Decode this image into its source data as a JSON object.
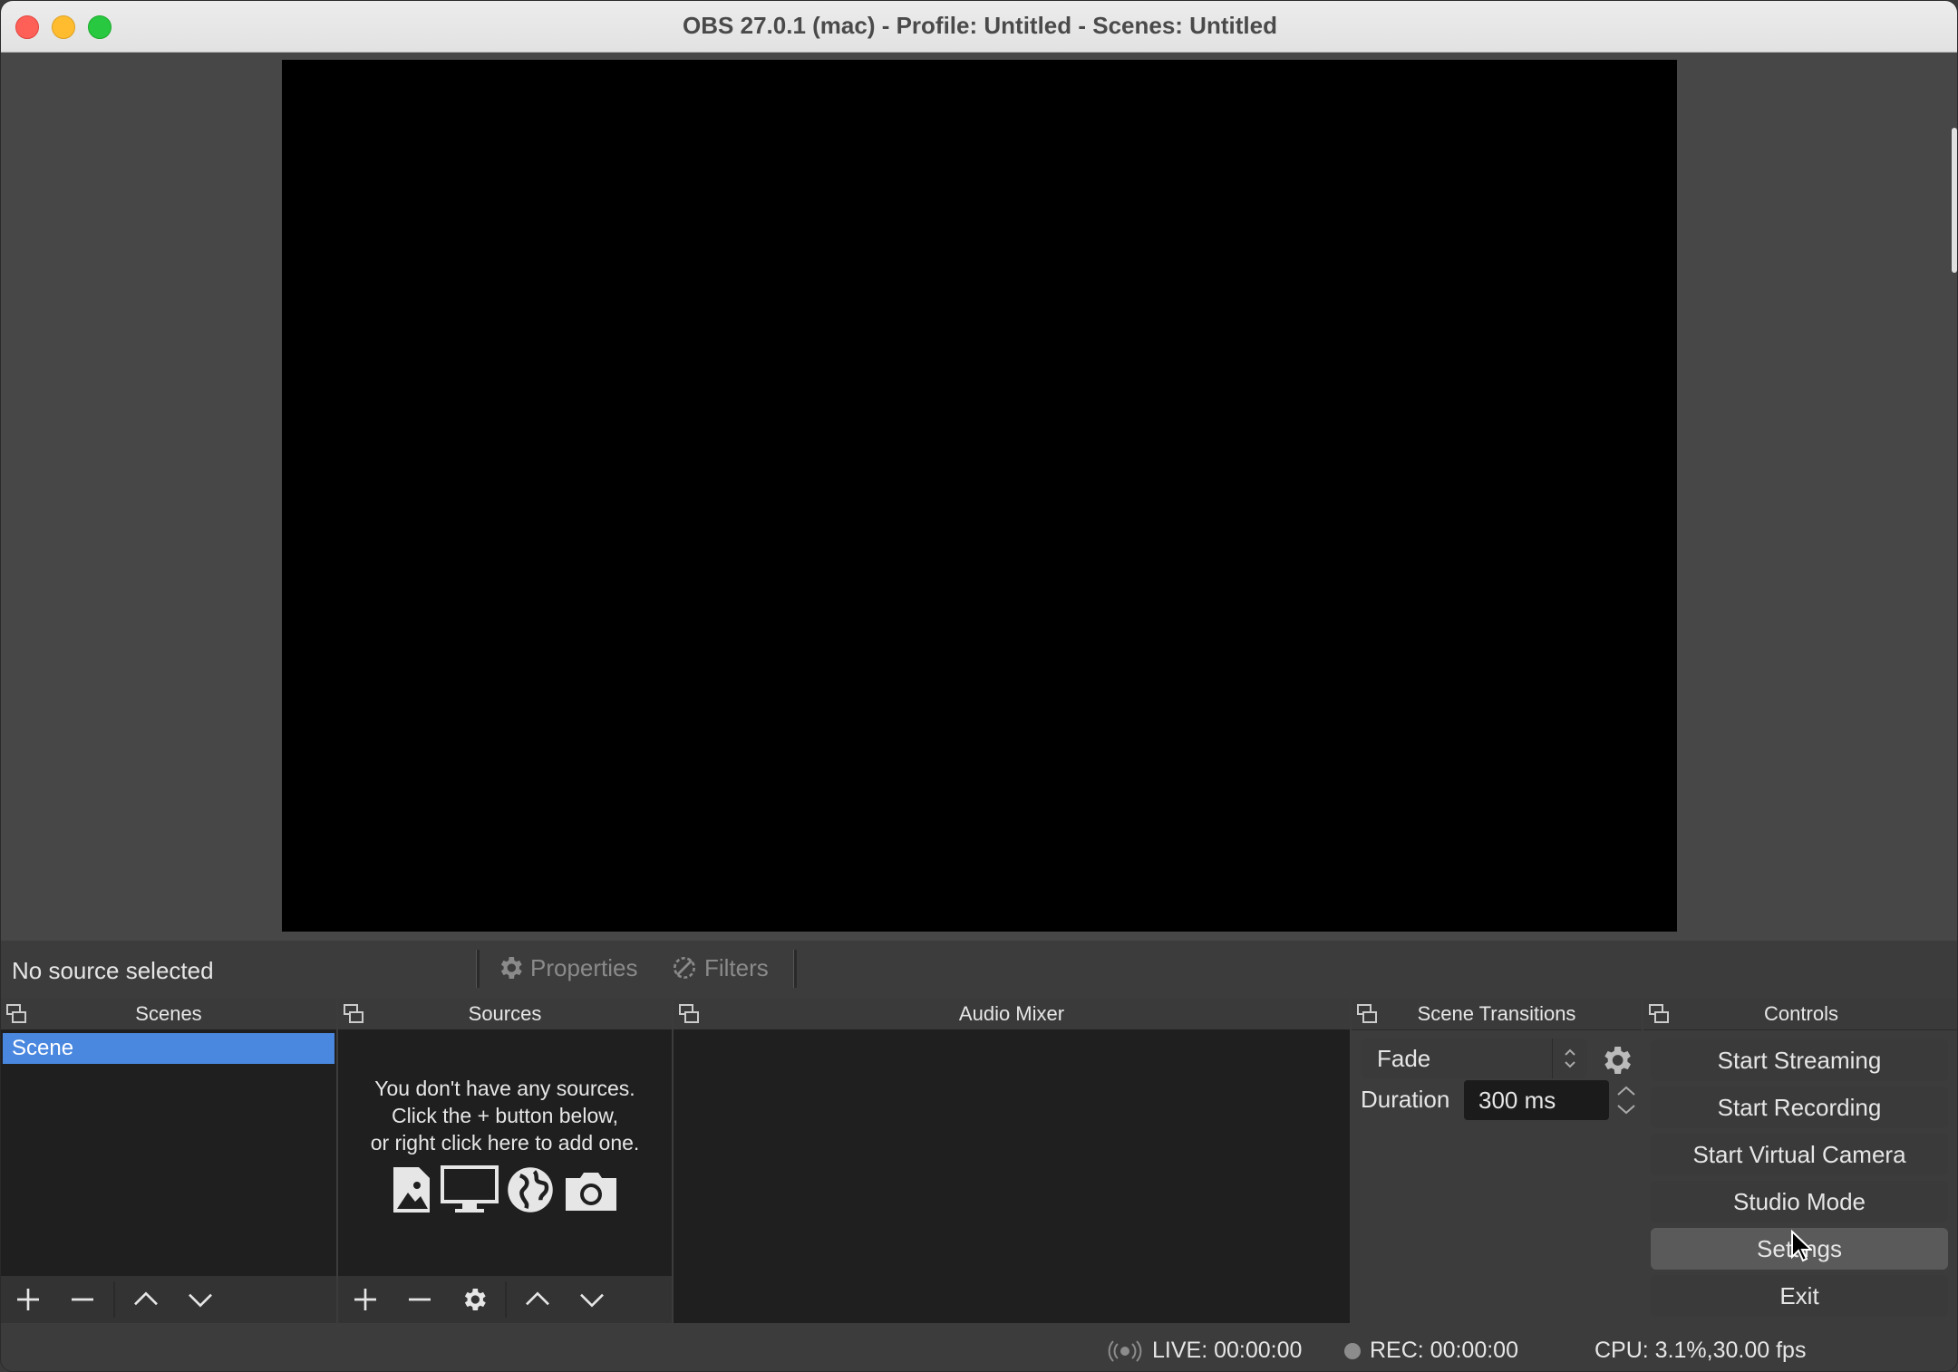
{
  "window": {
    "title": "OBS 27.0.1 (mac) - Profile: Untitled - Scenes: Untitled"
  },
  "source_toolbar": {
    "no_source_label": "No source selected",
    "properties_label": "Properties",
    "filters_label": "Filters"
  },
  "docks": {
    "scenes": {
      "title": "Scenes",
      "items": [
        {
          "label": "Scene",
          "selected": true
        }
      ]
    },
    "sources": {
      "title": "Sources",
      "empty_line1": "You don't have any sources.",
      "empty_line2": "Click the + button below,",
      "empty_line3": "or right click here to add one.",
      "icons": [
        "image-icon",
        "monitor-icon",
        "globe-icon",
        "camera-icon"
      ]
    },
    "audio_mixer": {
      "title": "Audio Mixer"
    },
    "scene_transitions": {
      "title": "Scene Transitions",
      "transition": "Fade",
      "duration_label": "Duration",
      "duration_value": "300 ms"
    },
    "controls": {
      "title": "Controls",
      "start_streaming": "Start Streaming",
      "start_recording": "Start Recording",
      "start_virtual_camera": "Start Virtual Camera",
      "studio_mode": "Studio Mode",
      "settings": "Settings",
      "exit": "Exit"
    }
  },
  "status": {
    "live": "LIVE: 00:00:00",
    "rec": "REC: 00:00:00",
    "cpu": "CPU: 3.1%,30.00 fps"
  },
  "colors": {
    "selection": "#4a88e0",
    "preview": "#000000",
    "panel_bg": "#1f1f1f"
  }
}
